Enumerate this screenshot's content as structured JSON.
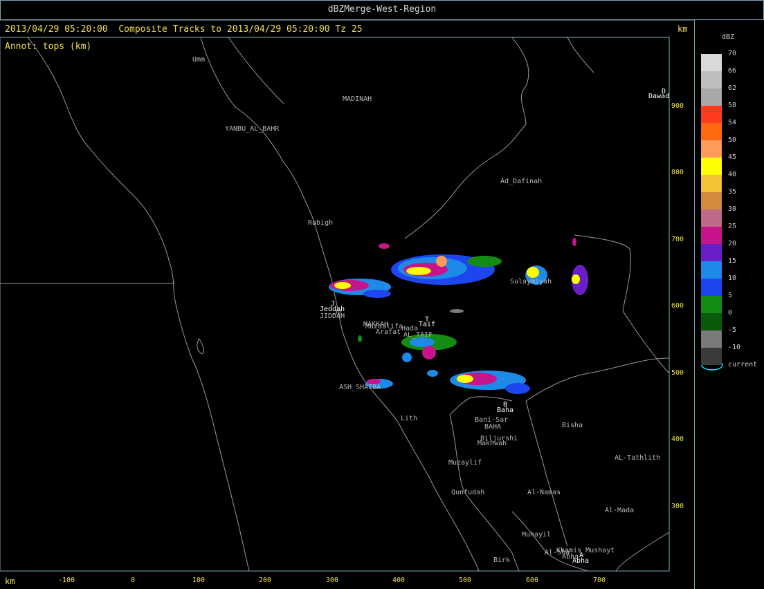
{
  "window_title": "dBZMerge-West-Region",
  "header": "2013/04/29 05:20:00  Composite Tracks to 2013/04/29 05:20:00 Tz 25",
  "annotation": "Annot: tops (km)",
  "units": {
    "top_right": "km",
    "bottom_left": "km"
  },
  "x_ticks": [
    "-100",
    "0",
    "100",
    "200",
    "300",
    "400",
    "500",
    "600",
    "700"
  ],
  "y_ticks": [
    "900",
    "800",
    "700",
    "600",
    "500",
    "400",
    "300"
  ],
  "legend": {
    "title": "dBZ",
    "bins": [
      {
        "label": "70",
        "color": "#d9d9d9"
      },
      {
        "label": "66",
        "color": "#bdbdbd"
      },
      {
        "label": "62",
        "color": "#a8a8a8"
      },
      {
        "label": "58",
        "color": "#ff3b1f"
      },
      {
        "label": "54",
        "color": "#ff6a10"
      },
      {
        "label": "50",
        "color": "#ff9a5c"
      },
      {
        "label": "45",
        "color": "#ffff00"
      },
      {
        "label": "40",
        "color": "#f5c238"
      },
      {
        "label": "35",
        "color": "#d38a3c"
      },
      {
        "label": "30",
        "color": "#c0688a"
      },
      {
        "label": "25",
        "color": "#c8148c"
      },
      {
        "label": "20",
        "color": "#6a1ec8"
      },
      {
        "label": "15",
        "color": "#1e8ae8"
      },
      {
        "label": "10",
        "color": "#1e46f0"
      },
      {
        "label": "5",
        "color": "#148c14"
      },
      {
        "label": "0",
        "color": "#0a5a0a"
      },
      {
        "label": "-5",
        "color": "#7a7a7a"
      },
      {
        "label": "-10",
        "color": "#3a3a3a"
      }
    ],
    "current_label": "current",
    "current_color": "#00e5ff"
  },
  "cities_gray": [
    "Umm",
    "MADINAH",
    "YANBU_AL_BAHR",
    "Ad_Dafinah",
    "Rabigh",
    "Sulaymiyah",
    "JIDDAH",
    "MAKKAH",
    "Muzdalifa",
    "Hada",
    "Arafat",
    "AL_TAIF",
    "ASH_SHAIBA",
    "Lith",
    "Bani-Sar",
    "BAHA",
    "Bisha",
    "Biljurshi",
    "Makhwah",
    "AL-Tathlith",
    "Muzaylif",
    "Qunfudah",
    "Al-Namas",
    "Al-Mada",
    "Muhayil",
    "Khamis_Mushayt",
    "Al-Sha",
    "Birk",
    "Abha"
  ],
  "cities_white": [
    "D",
    "Dawad",
    "J",
    "Jeddah",
    "T",
    "Taif",
    "B",
    "Baha",
    "A",
    "Abha"
  ],
  "extra_labels": [
    "J2"
  ]
}
